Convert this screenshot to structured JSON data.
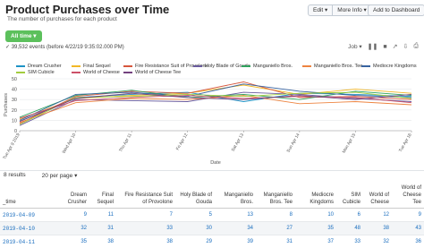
{
  "header": {
    "title": "Product Purchases over Time",
    "description": "The number of purchases for each product",
    "edit_label": "Edit ▾",
    "more_info_label": "More Info ▾",
    "add_dashboard_label": "Add to Dashboard"
  },
  "search": {
    "time_range_label": "All time ▾",
    "events_text": "✓ 39,532 events (before 4/22/19 9:35:02.000 PM)",
    "job_label": "Job ▾"
  },
  "colors": {
    "time_button": "#5cc05c",
    "link": "#1a6ebf"
  },
  "chart_data": {
    "type": "line",
    "x": [
      "Tue Apr 9 2019",
      "Wed Apr 10",
      "Thu Apr 11",
      "Fri Apr 12",
      "Sat Apr 13",
      "Sun Apr 14",
      "Mon Apr 15",
      "Tue Apr 16"
    ],
    "xlabel": "Date",
    "ylabel": "Purchases",
    "ylim": [
      0,
      50
    ],
    "yticks": [
      "0",
      "10",
      "20",
      "30",
      "40",
      "50"
    ],
    "grid": true,
    "legend": "top",
    "series": [
      {
        "name": "Dream Crusher",
        "color": "#1e93c6",
        "values": [
          9,
          32,
          35,
          37,
          28,
          36,
          35,
          33
        ]
      },
      {
        "name": "Final Sequel",
        "color": "#f2b827",
        "values": [
          11,
          31,
          34,
          36,
          44,
          35,
          40,
          36
        ]
      },
      {
        "name": "Fire Resistance Suit of Provolone",
        "color": "#d6563c",
        "values": [
          7,
          33,
          38,
          36,
          47,
          32,
          33,
          30
        ]
      },
      {
        "name": "Holy Blade of Gouda",
        "color": "#6a5c9e",
        "values": [
          5,
          30,
          29,
          28,
          37,
          35,
          31,
          28
        ]
      },
      {
        "name": "Manganiello Bros.",
        "color": "#31a35f",
        "values": [
          13,
          34,
          39,
          32,
          35,
          30,
          38,
          34
        ]
      },
      {
        "name": "Manganiello Bros. Tee",
        "color": "#ed8440",
        "values": [
          8,
          27,
          31,
          30,
          34,
          26,
          28,
          25
        ]
      },
      {
        "name": "Mediocre Kingdoms",
        "color": "#3863a0",
        "values": [
          10,
          35,
          37,
          33,
          45,
          38,
          34,
          32
        ]
      },
      {
        "name": "SIM Cubicle",
        "color": "#a2cc3e",
        "values": [
          6,
          32,
          33,
          35,
          33,
          36,
          37,
          31
        ]
      },
      {
        "name": "World of Cheese",
        "color": "#cc5068",
        "values": [
          12,
          29,
          32,
          34,
          31,
          33,
          32,
          27
        ]
      },
      {
        "name": "World of Cheese Tee",
        "color": "#73427f",
        "values": [
          9,
          31,
          36,
          32,
          30,
          34,
          30,
          35
        ]
      }
    ]
  },
  "results": {
    "count_label": "8 results",
    "per_page_label": "20 per page ▾",
    "columns": [
      "_time",
      "Dream Crusher",
      "Final Sequel",
      "Fire Resistance Suit of Provolone",
      "Holy Blade of Gouda",
      "Manganiello Bros.",
      "Manganiello Bros. Tee",
      "Mediocre Kingdoms",
      "SIM Cubicle",
      "World of Cheese",
      "World of Cheese Tee"
    ],
    "rows": [
      [
        "2019-04-09",
        "9",
        "11",
        "7",
        "5",
        "13",
        "8",
        "10",
        "6",
        "12",
        "9"
      ],
      [
        "2019-04-10",
        "32",
        "31",
        "33",
        "30",
        "34",
        "27",
        "35",
        "48",
        "38",
        "43"
      ],
      [
        "2019-04-11",
        "35",
        "38",
        "38",
        "29",
        "39",
        "31",
        "37",
        "33",
        "32",
        "36"
      ]
    ]
  }
}
